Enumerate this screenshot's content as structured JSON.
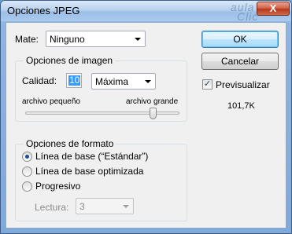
{
  "window": {
    "title": "Opciones JPEG",
    "close_glyph": "X",
    "watermark_line1": "aula",
    "watermark_line2": "Clic"
  },
  "matte": {
    "label": "Mate:",
    "value": "Ninguno"
  },
  "buttons": {
    "ok": "OK",
    "cancel": "Cancelar"
  },
  "image_options": {
    "title": "Opciones de imagen",
    "quality_label": "Calidad:",
    "quality_value": "10",
    "quality_preset": "Máxima",
    "small_file": "archivo pequeño",
    "large_file": "archivo grande",
    "slider_fraction": 0.83
  },
  "preview": {
    "label": "Previsualizar",
    "checked": true,
    "file_size": "101,7K"
  },
  "format_options": {
    "title": "Opciones de formato",
    "options": [
      {
        "label": "Línea de base (“Estándar”)",
        "checked": true
      },
      {
        "label": "Línea de base optimizada",
        "checked": false
      },
      {
        "label": "Progresivo",
        "checked": false
      }
    ],
    "scans_label": "Lectura:",
    "scans_value": "3"
  },
  "colors": {
    "title_bar": "#b7d1ee",
    "close_button": "#c64a2c",
    "selection": "#3399ff"
  }
}
